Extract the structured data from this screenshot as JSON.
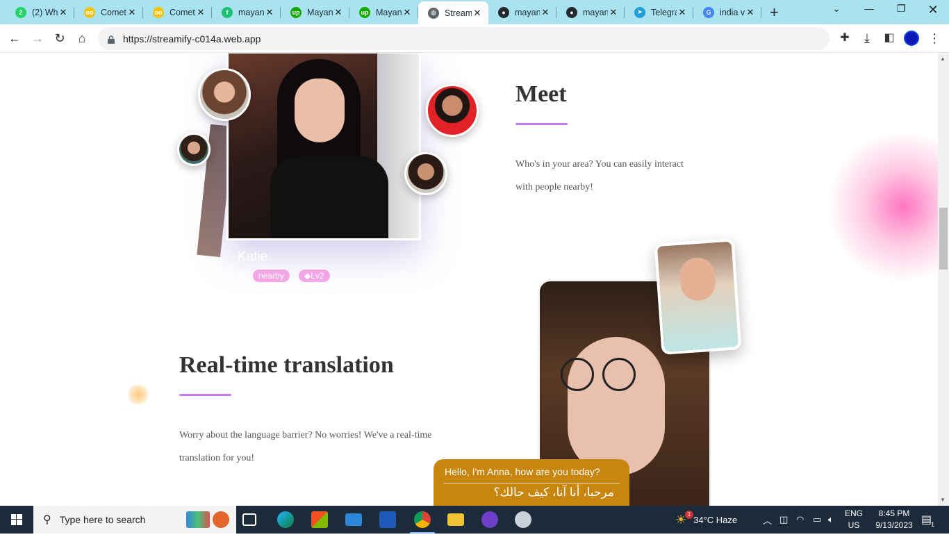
{
  "browser": {
    "tabs": [
      {
        "label": "(2) Wh",
        "icon": "whatsapp-icon",
        "color": "#25d366",
        "glyph": "2"
      },
      {
        "label": "Comet",
        "icon": "comet-icon",
        "color": "#f4c20d",
        "glyph": "oo"
      },
      {
        "label": "Comet",
        "icon": "comet-icon",
        "color": "#f4c20d",
        "glyph": "oo"
      },
      {
        "label": "mayan",
        "icon": "fiverr-icon",
        "color": "#1dbf73",
        "glyph": "f"
      },
      {
        "label": "Mayan",
        "icon": "upwork-icon",
        "color": "#14a800",
        "glyph": "up"
      },
      {
        "label": "Mayan",
        "icon": "upwork-icon",
        "color": "#14a800",
        "glyph": "up"
      },
      {
        "label": "Stream",
        "icon": "globe-icon",
        "color": "#5f6368",
        "glyph": "◍",
        "active": true
      },
      {
        "label": "mayan",
        "icon": "github-icon",
        "color": "#24292f",
        "glyph": "●"
      },
      {
        "label": "mayan",
        "icon": "github-icon",
        "color": "#24292f",
        "glyph": "●"
      },
      {
        "label": "Telegra",
        "icon": "telegram-icon",
        "color": "#229ed9",
        "glyph": "➤"
      },
      {
        "label": "india v",
        "icon": "google-icon",
        "color": "#4285f4",
        "glyph": "G"
      }
    ],
    "url": "https://streamify-c014a.web.app"
  },
  "page": {
    "meet": {
      "title": "Meet",
      "text_line1": "Who's in your area? You can easily interact",
      "text_line2": "with people nearby!",
      "card_name": "Katie",
      "badge_nearby": "nearby",
      "badge_level": "Lv2"
    },
    "translation": {
      "title": "Real-time translation",
      "text_line1": "Worry about the language barrier? No worries! We've a real-time",
      "text_line2": "translation for you!",
      "bubble_en": "Hello, I'm Anna, how are you today?",
      "bubble_ar": "مرحبا، أنا آنا، كيف حالك؟"
    },
    "accent": "#c67bf5"
  },
  "taskbar": {
    "search_placeholder": "Type here to search",
    "weather": "34°C  Haze",
    "weather_badge": "1",
    "lang_top": "ENG",
    "lang_bottom": "US",
    "time": "8:45 PM",
    "date": "9/13/2023",
    "notif_count": "1"
  }
}
